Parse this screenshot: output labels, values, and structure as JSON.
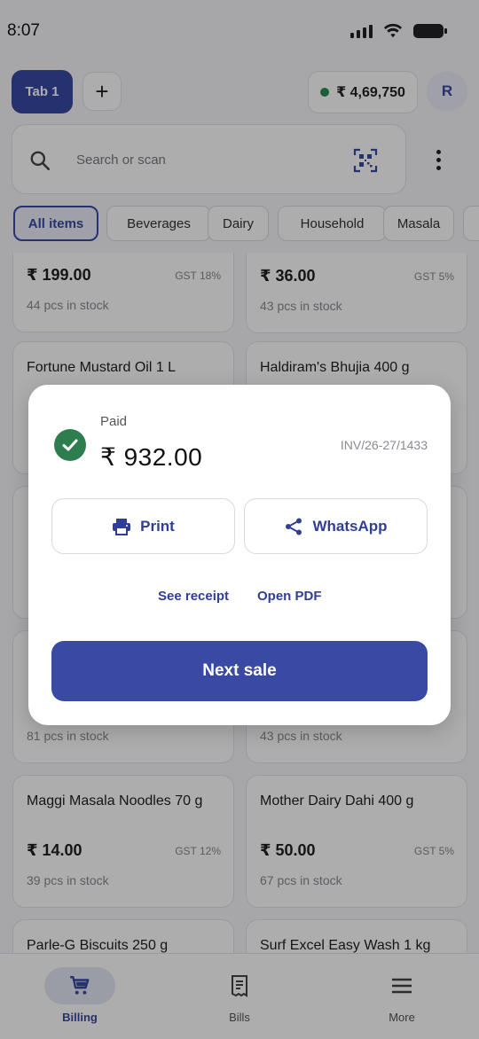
{
  "status_bar": {
    "time": "8:07"
  },
  "top_bar": {
    "tab_label": "Tab 1",
    "add_tab_label": "+",
    "balance": "₹ 4,69,750",
    "avatar_initial": "R"
  },
  "search": {
    "placeholder": "Search or scan"
  },
  "categories": [
    "All items",
    "Beverages",
    "Dairy",
    "Household",
    "Masala"
  ],
  "products": [
    {
      "name": "",
      "price": "₹ 199.00",
      "gst": "GST 18%",
      "stock": "44 pcs in stock"
    },
    {
      "name": "",
      "price": "₹ 36.00",
      "gst": "GST 5%",
      "stock": "43 pcs in stock"
    },
    {
      "name": "Fortune Mustard Oil 1 L",
      "price": "",
      "gst": "",
      "stock": ""
    },
    {
      "name": "Haldiram's Bhujia 400 g",
      "price": "",
      "gst": "",
      "stock": ""
    },
    {
      "name": "",
      "price": "",
      "gst": "",
      "stock": ""
    },
    {
      "name": "",
      "price": "",
      "gst": "",
      "stock": ""
    },
    {
      "name": "",
      "price": "",
      "gst": "",
      "stock": "81 pcs in stock"
    },
    {
      "name": "",
      "price": "",
      "gst": "",
      "stock": "43 pcs in stock"
    },
    {
      "name": "Maggi Masala Noodles 70 g",
      "price": "₹ 14.00",
      "gst": "GST 12%",
      "stock": "39 pcs in stock"
    },
    {
      "name": "Mother Dairy Dahi 400 g",
      "price": "₹ 50.00",
      "gst": "GST 5%",
      "stock": "67 pcs in stock"
    },
    {
      "name": "Parle-G Biscuits 250 g",
      "price": "",
      "gst": "",
      "stock": ""
    },
    {
      "name": "Surf Excel Easy Wash 1 kg",
      "price": "",
      "gst": "",
      "stock": ""
    }
  ],
  "dialog": {
    "status": "Paid",
    "amount": "₹ 932.00",
    "invoice": "INV/26-27/1433",
    "print_label": "Print",
    "whatsapp_label": "WhatsApp",
    "see_receipt_label": "See receipt",
    "open_pdf_label": "Open PDF",
    "next_sale_label": "Next sale"
  },
  "bottom_nav": [
    {
      "label": "Billing",
      "icon": "cart-icon",
      "active": true
    },
    {
      "label": "Bills",
      "icon": "receipt-icon",
      "active": false
    },
    {
      "label": "More",
      "icon": "menu-icon",
      "active": false
    }
  ],
  "colors": {
    "primary": "#3949a4",
    "success": "#2e7d4f",
    "background": "#f7f6f9"
  }
}
